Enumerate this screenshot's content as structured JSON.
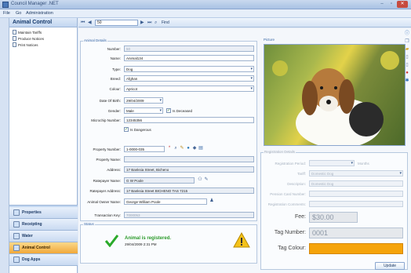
{
  "window": {
    "title": "Council Manager .NET"
  },
  "menu": {
    "file": "File",
    "go": "Go",
    "admin": "Administration"
  },
  "sidebar": {
    "title": "Animal Control",
    "items": [
      {
        "label": "Maintain Tariffs"
      },
      {
        "label": "Produce Notices"
      },
      {
        "label": "Print Notices"
      }
    ],
    "nav": [
      {
        "label": "Properties"
      },
      {
        "label": "Receipting"
      },
      {
        "label": "Water"
      },
      {
        "label": "Animal Control"
      },
      {
        "label": "Dog Apps"
      }
    ]
  },
  "toolbar": {
    "record": "50",
    "find": "Find"
  },
  "animal": {
    "caption": "Animal Details",
    "number_label": "Number:",
    "number": "50",
    "name_label": "Name:",
    "name": "Animal134",
    "type_label": "Type:",
    "type": "Dog",
    "breed_label": "Breed:",
    "breed": "Afghan",
    "colour_label": "Colour:",
    "colour": "Apricot",
    "dob_label": "Date Of Birth:",
    "dob": "29/04/2009",
    "gender_label": "Gender:",
    "gender": "Male",
    "deceased_label": "Is Deceased",
    "microchip_label": "Microchip Number:",
    "microchip": "12345356",
    "dangerous_label": "Is Dangerous"
  },
  "property": {
    "number_label": "Property Number:",
    "number": "1-0000-035",
    "name_label": "Property Name:",
    "name": "",
    "address_label": "Address:",
    "address": "17 Banksia Street, Bicheno",
    "payer_label": "Ratepayer Name:",
    "payer": "G W Poole",
    "payer_addr_label": "Ratepayer Address:",
    "payer_addr": "17 Banksia Street BICHENO  TAS  7215",
    "owner_label": "Animal Owner Name:",
    "owner": "George William Poole",
    "txn_label": "Transaction Key:",
    "txn": "7000053"
  },
  "status": {
    "caption": "Status",
    "message": "Animal is registered.",
    "date": "29/04/2009 2:31 PM"
  },
  "picture": {
    "caption": "Picture"
  },
  "registration": {
    "caption": "Registration Details",
    "period_label": "Registration Period:",
    "months": "Months",
    "tariff_label": "Tariff:",
    "tariff": "Domestic Dog",
    "desc_label": "Description:",
    "desc": "Domestic Dog",
    "pension_label": "Pension Card Number:",
    "comments_label": "Registration Comments:",
    "fee_label": "Fee:",
    "fee": "$30.00",
    "tag_label": "Tag Number:",
    "tag": "0001",
    "tagcolour_label": "Tag Colour:",
    "tag_colour_hex": "#f5a40b"
  },
  "buttons": {
    "update": "Update"
  }
}
